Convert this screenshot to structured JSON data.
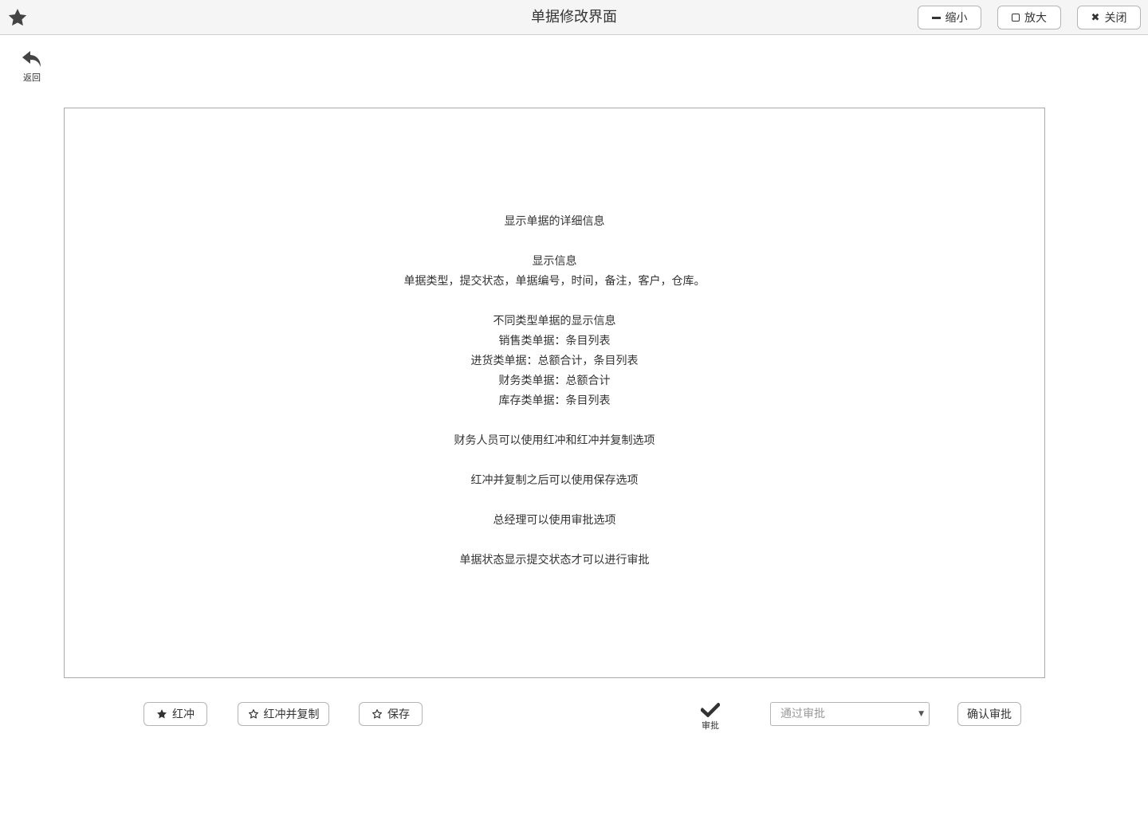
{
  "window": {
    "title": "单据修改界面",
    "minimize_label": "缩小",
    "maximize_label": "放大",
    "close_label": "关闭"
  },
  "nav": {
    "back_label": "返回"
  },
  "info_panel": {
    "lines": [
      "显示单据的详细信息",
      "",
      "显示信息",
      "单据类型，提交状态，单据编号，时间，备注，客户，仓库。",
      "",
      "不同类型单据的显示信息",
      "销售类单据：条目列表",
      "进货类单据：总额合计，条目列表",
      "财务类单据：总额合计",
      "库存类单据：条目列表",
      "",
      "财务人员可以使用红冲和红冲并复制选项",
      "",
      "红冲并复制之后可以使用保存选项",
      "",
      "总经理可以使用审批选项",
      "",
      "单据状态显示提交状态才可以进行审批"
    ]
  },
  "toolbar": {
    "red_flush_label": "红冲",
    "red_flush_copy_label": "红冲并复制",
    "save_label": "保存",
    "approve_label": "审批",
    "approval_select_value": "通过审批",
    "confirm_approval_label": "确认审批"
  },
  "icons": {
    "app": "star-icon",
    "back": "undo-arrow-icon",
    "red_flush": "star-filled-icon",
    "red_flush_copy": "star-outline-icon",
    "save": "star-outline-icon",
    "approve": "checkmark-icon",
    "select": "caret-down-icon"
  }
}
